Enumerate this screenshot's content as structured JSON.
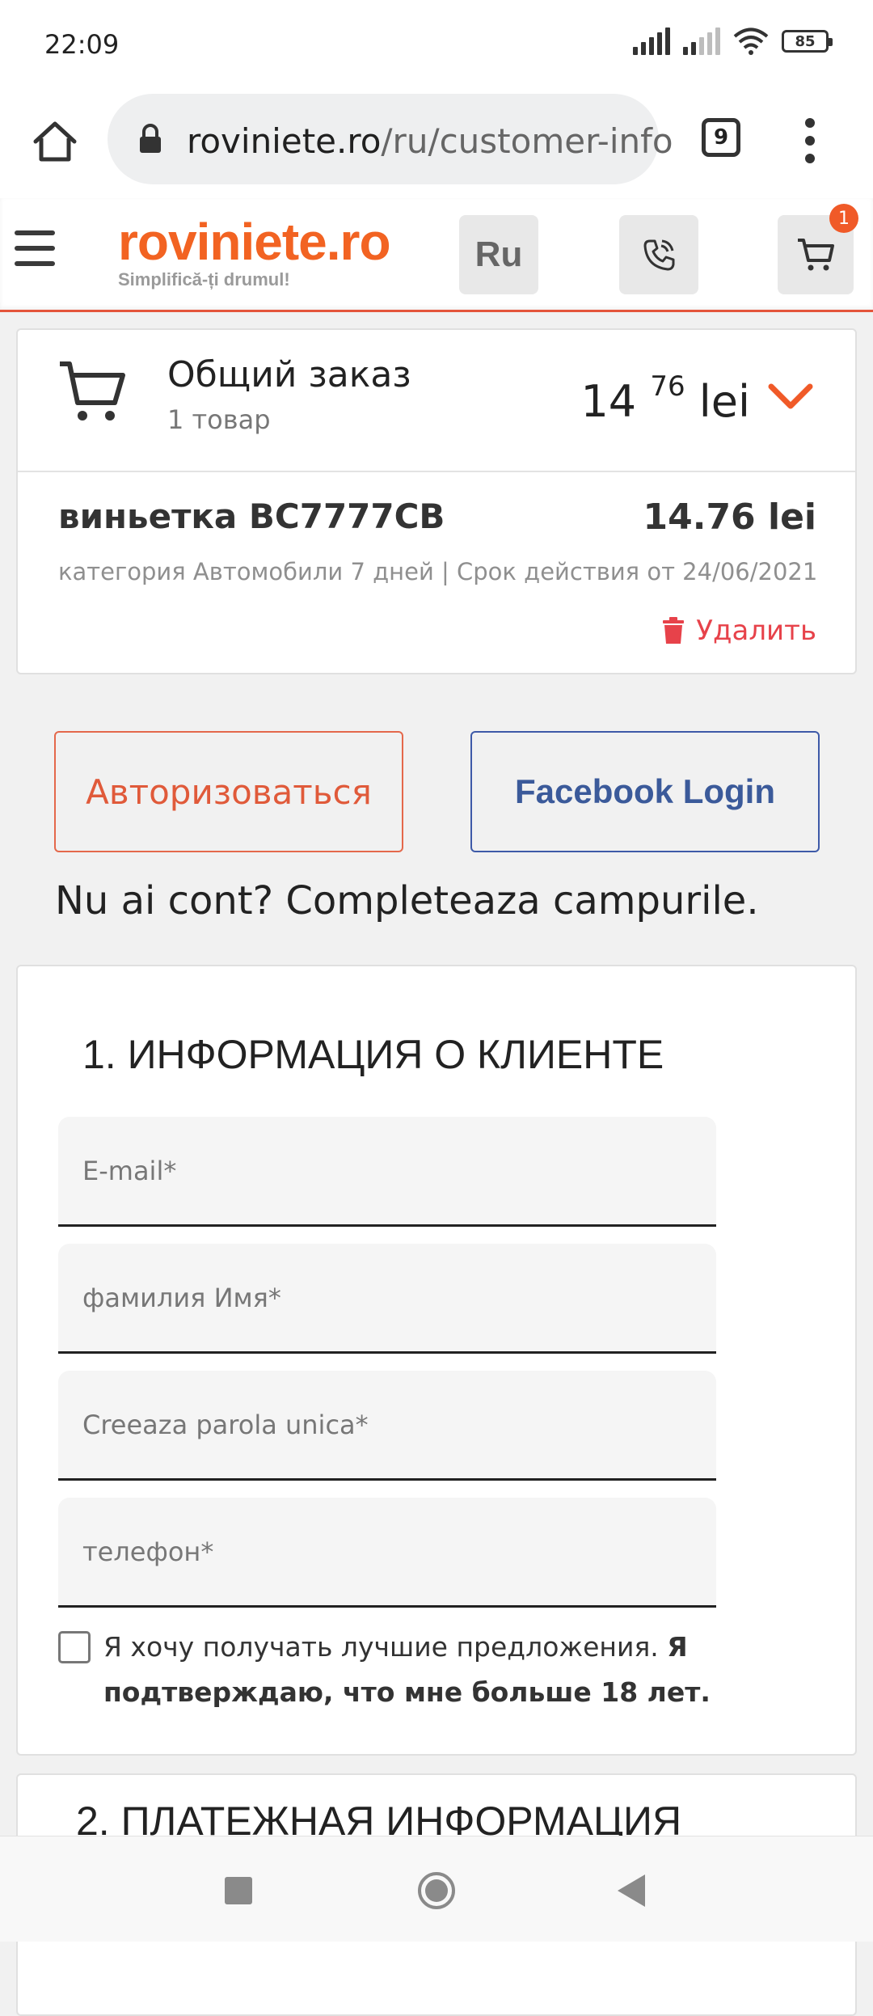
{
  "status_bar": {
    "time": "22:09",
    "battery": "85"
  },
  "browser": {
    "url_host": "roviniete.ro",
    "url_path": "/ru/customer-info",
    "tab_count": "9"
  },
  "header": {
    "brand": "roviniete.ro",
    "tagline": "Simplifică-ți drumul!",
    "language": "Ru",
    "cart_badge": "1"
  },
  "order": {
    "title": "Общий заказ",
    "count": "1 товар",
    "total_int": "14",
    "total_dec": "76",
    "currency": "lei",
    "item": {
      "name": "виньетка BC7777CB",
      "price": "14.76 lei",
      "description": "категория Автомобили 7 дней | Срок действия от 24/06/2021",
      "delete_label": "Удалить"
    }
  },
  "auth": {
    "login_label": "Авторизоваться",
    "facebook_label": "Facebook Login",
    "no_account": "Nu ai cont? Completeaza campurile."
  },
  "customer_info": {
    "title": "1. ИНФОРМАЦИЯ О КЛИЕНТЕ",
    "email_placeholder": "E-mail*",
    "name_placeholder": "фамилия Имя*",
    "password_placeholder": "Creeaza parola unica*",
    "phone_placeholder": "телефон*",
    "consent_text": "Я хочу получать лучшие предложения.",
    "consent_bold": "Я подтверждаю, что мне больше 18 лет."
  },
  "payment": {
    "title": "2. ПЛАТЕЖНАЯ ИНФОРМАЦИЯ"
  },
  "colors": {
    "brand_orange": "#f26322",
    "facebook_blue": "#3b5a9a",
    "delete_red": "#e7424a"
  }
}
